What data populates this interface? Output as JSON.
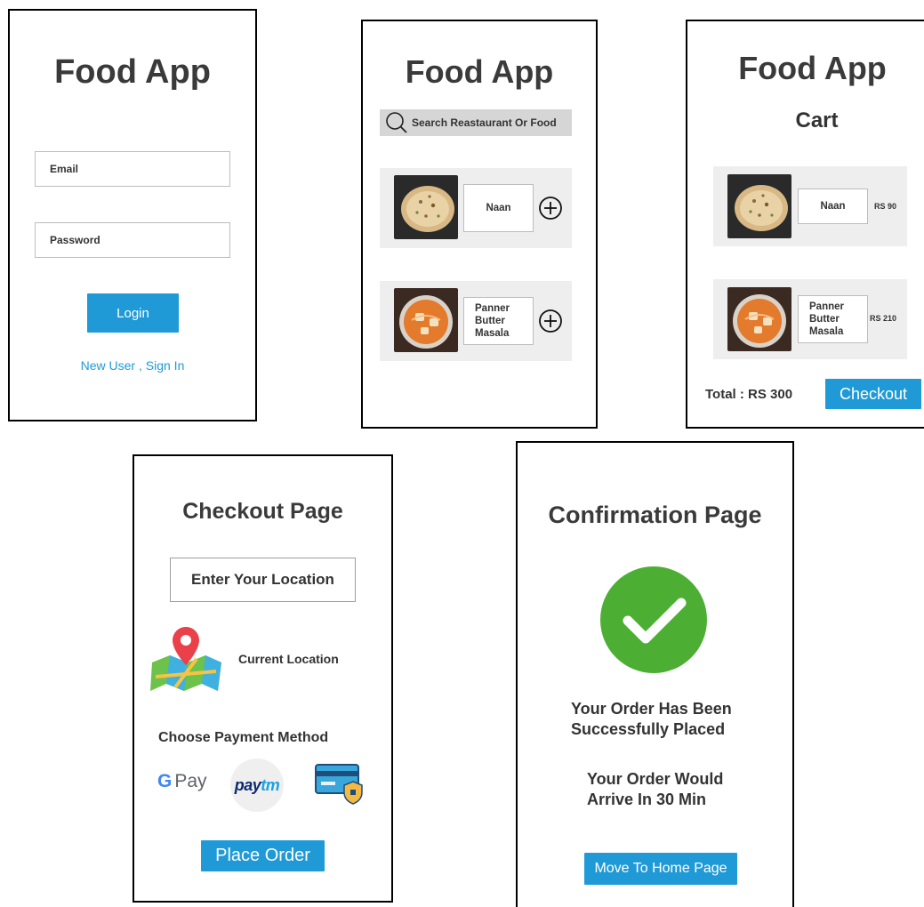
{
  "login": {
    "title": "Food App",
    "email_placeholder": "Email",
    "password_placeholder": "Password",
    "login_label": "Login",
    "signup_link": "New User , Sign In"
  },
  "menu": {
    "title": "Food App",
    "search_placeholder": "Search Reastaurant Or Food",
    "items": [
      {
        "name": "Naan",
        "image": "naan-image",
        "action_icon": "plus-circle-icon"
      },
      {
        "name": "Panner\nButter\nMasala",
        "image": "paneer-butter-masala-image",
        "action_icon": "plus-circle-icon"
      }
    ]
  },
  "cart": {
    "title": "Food App",
    "subtitle": "Cart",
    "items": [
      {
        "name": "Naan",
        "price": "RS 90"
      },
      {
        "name": "Panner\nButter\nMasala",
        "price": "RS 210"
      }
    ],
    "total": "Total : RS 300",
    "checkout_label": "Checkout"
  },
  "checkout": {
    "title": "Checkout Page",
    "location_placeholder": "Enter Your Location",
    "current_location": "Current Location",
    "payment_title": "Choose Payment Method",
    "payment_methods": [
      "G Pay",
      "paytm",
      "card-icon"
    ],
    "gpay_g": "G",
    "gpay_label": "Pay",
    "paytm_pay": "pay",
    "paytm_tm": "tm",
    "place_order_label": "Place Order"
  },
  "confirmation": {
    "title": "Confirmation Page",
    "message_line1": "Your Order Has Been",
    "message_line2": "Successfully Placed",
    "eta_line1": "Your Order Would",
    "eta_line2": "Arrive In 30 Min",
    "home_label": "Move To Home Page"
  },
  "colors": {
    "accent": "#1f9ad7",
    "success": "#4caf34",
    "card_bg": "#eeeeee",
    "search_bg": "#d6d6d6"
  }
}
